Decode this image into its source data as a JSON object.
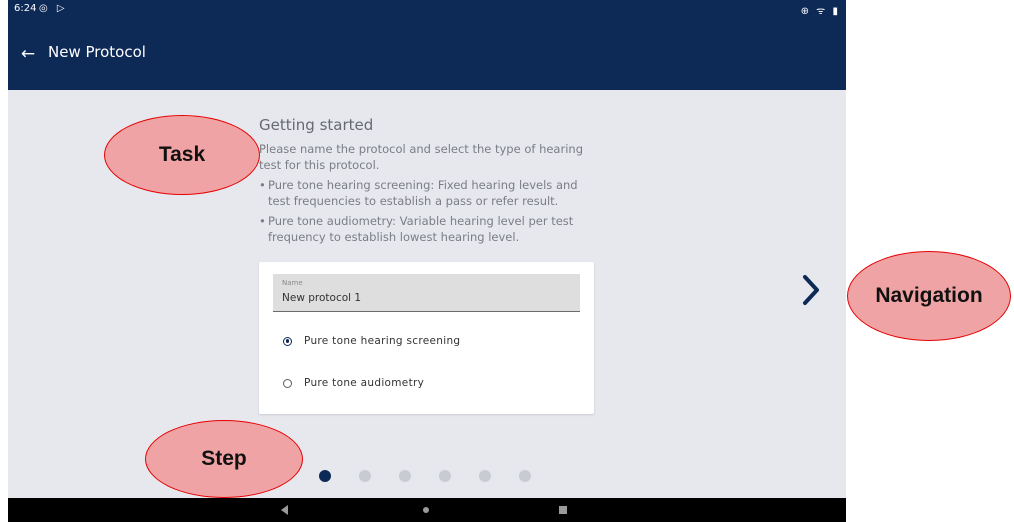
{
  "status_bar": {
    "time": "6:24",
    "left_icons": "◎ ▷",
    "right_icons": "⊕ ᯤ ▮"
  },
  "app_bar": {
    "title": "New Protocol",
    "back_icon": "←"
  },
  "content": {
    "heading": "Getting started",
    "intro": "Please name the protocol and select the type of hearing test for this protocol.",
    "bullets": [
      "Pure tone hearing screening: Fixed hearing levels and test frequencies to establish a pass or refer result.",
      "Pure tone audiometry: Variable hearing level per test frequency to establish lowest hearing level."
    ]
  },
  "form": {
    "name_label": "Name",
    "name_value": "New protocol 1",
    "options": [
      {
        "label": "Pure tone hearing screening",
        "selected": true
      },
      {
        "label": "Pure tone audiometry",
        "selected": false
      }
    ]
  },
  "stepper": {
    "total_steps": 6,
    "current_step": 1
  },
  "annotations": {
    "task": "Task",
    "step": "Step",
    "navigation": "Navigation"
  },
  "colors": {
    "primary": "#0d2a57",
    "background": "#e6e8ee",
    "callout_fill": "#f0a3a5",
    "callout_border": "#e60000"
  }
}
